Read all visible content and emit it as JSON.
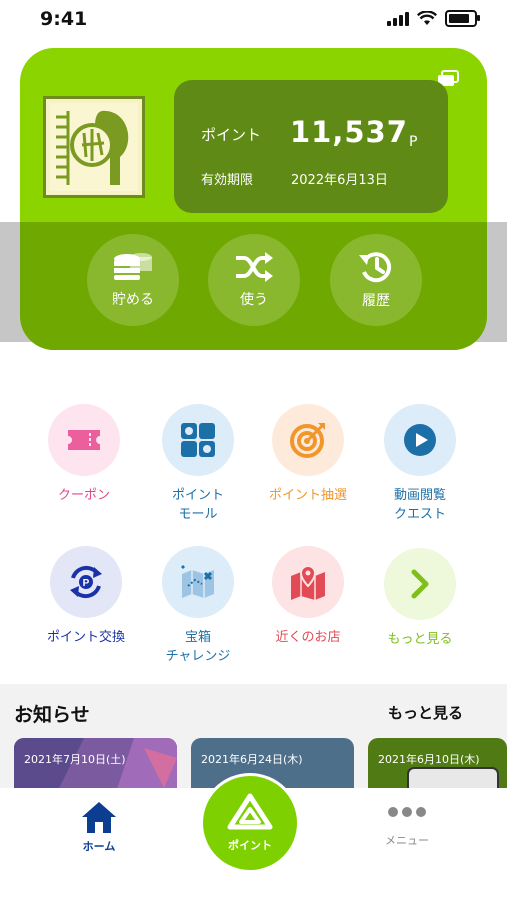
{
  "status_bar": {
    "time": "9:41"
  },
  "card": {
    "point_label": "ポイント",
    "point_value": "11,537",
    "point_unit": "P",
    "expiry_label": "有効期限",
    "expiry_date": "2022年6月13日"
  },
  "actions": [
    {
      "label": "貯める",
      "icon": "coins-icon"
    },
    {
      "label": "使う",
      "icon": "shuffle-icon"
    },
    {
      "label": "履歴",
      "icon": "history-icon"
    }
  ],
  "menu": {
    "row1": [
      {
        "label": "クーポン",
        "icon": "coupon-icon",
        "color": "#e4478a"
      },
      {
        "label": "ポイント\nモール",
        "icon": "mall-icon",
        "color": "#1d6fa8"
      },
      {
        "label": "ポイント抽選",
        "icon": "target-icon",
        "color": "#f0962b"
      },
      {
        "label": "動画閲覧\nクエスト",
        "icon": "play-icon",
        "color": "#1d6fa8"
      }
    ],
    "row2": [
      {
        "label": "ポイント交換",
        "icon": "exchange-icon",
        "color": "#1a32a8"
      },
      {
        "label": "宝箱\nチャレンジ",
        "icon": "treasure-map-icon",
        "color": "#1d6fa8"
      },
      {
        "label": "近くのお店",
        "icon": "map-pin-icon",
        "color": "#e24b55"
      },
      {
        "label": "もっと見る",
        "icon": "chevron-right-icon",
        "color": "#7fbf1a"
      }
    ]
  },
  "notice": {
    "title": "お知らせ",
    "more": "もっと見る",
    "items": [
      {
        "date": "2021年7月10日(土)"
      },
      {
        "date": "2021年6月24日(木)"
      },
      {
        "date": "2021年6月10日(木)"
      }
    ]
  },
  "tabbar": {
    "home": "ホーム",
    "point": "ポイント",
    "menu": "メニュー"
  },
  "colors": {
    "brand_green": "#8cd400",
    "card_dark": "#5f8a16",
    "tab_active": "#0b3d91"
  }
}
